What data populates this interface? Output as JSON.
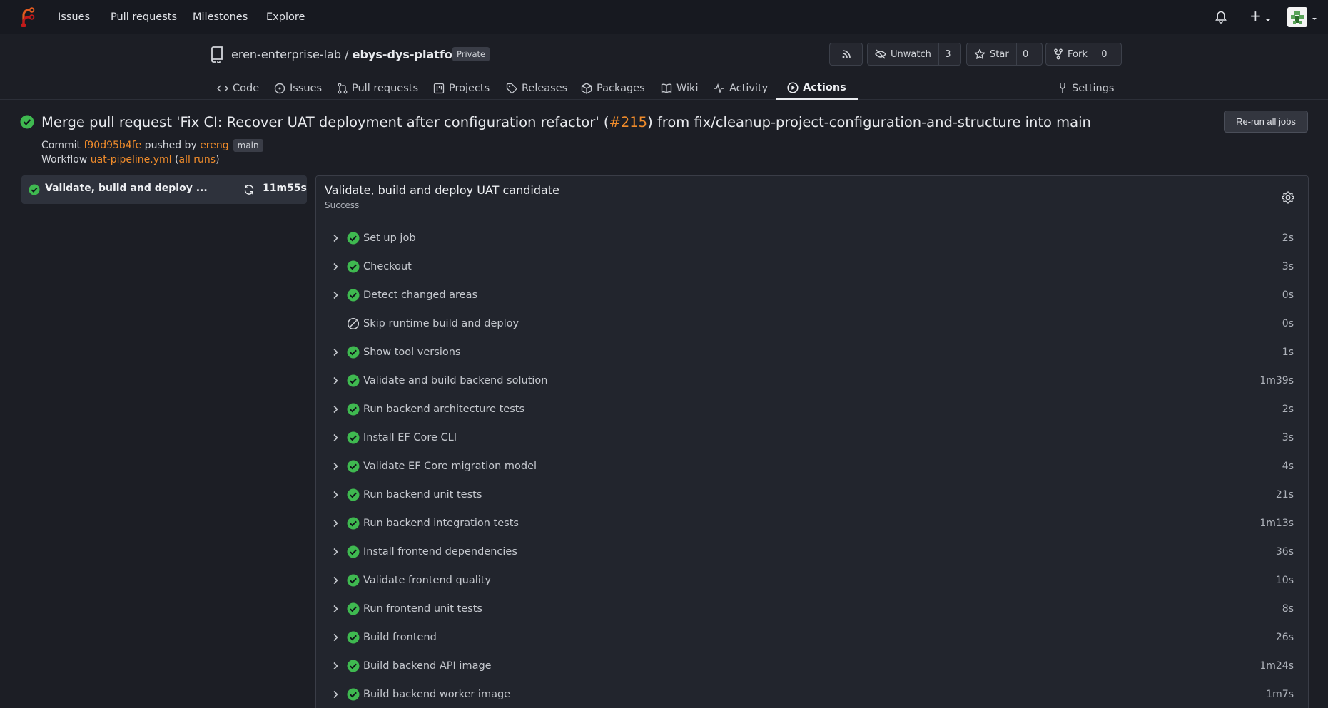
{
  "topnav": {
    "links": [
      "Issues",
      "Pull requests",
      "Milestones",
      "Explore"
    ],
    "plus_label": "+"
  },
  "repo": {
    "owner": "eren-enterprise-lab",
    "separator": " / ",
    "name": "ebys-dys-platform",
    "visibility": "Private",
    "watch": {
      "label": "Unwatch",
      "count": "3"
    },
    "star": {
      "label": "Star",
      "count": "0"
    },
    "fork": {
      "label": "Fork",
      "count": "0"
    }
  },
  "tabs": [
    {
      "label": "Code",
      "icon": "code-icon"
    },
    {
      "label": "Issues",
      "icon": "issue-icon"
    },
    {
      "label": "Pull requests",
      "icon": "pull-request-icon"
    },
    {
      "label": "Projects",
      "icon": "project-icon"
    },
    {
      "label": "Releases",
      "icon": "tag-icon"
    },
    {
      "label": "Packages",
      "icon": "package-icon"
    },
    {
      "label": "Wiki",
      "icon": "book-icon"
    },
    {
      "label": "Activity",
      "icon": "pulse-icon"
    },
    {
      "label": "Actions",
      "icon": "play-icon",
      "active": true
    },
    {
      "label": "Settings",
      "icon": "tools-icon"
    }
  ],
  "run": {
    "title_before": "Merge pull request 'Fix CI: Recover UAT deployment after configuration refactor' (",
    "pr_ref": "#215",
    "title_after": ") from fix/cleanup-project-configuration-and-structure into main",
    "rerun_label": "Re-run all jobs",
    "commit_label": "Commit ",
    "commit_sha": "f90d95b4fe",
    "pushed_by_label": " pushed by ",
    "pusher": "ereng",
    "branch": "main",
    "workflow_label": "Workflow ",
    "workflow_file": "uat-pipeline.yml",
    "all_runs_open": " (",
    "all_runs": "all runs",
    "all_runs_close": ")"
  },
  "job_list": [
    {
      "name": "Validate, build and deploy ...",
      "duration": "11m55s",
      "status": "success"
    }
  ],
  "job": {
    "title": "Validate, build and deploy UAT candidate",
    "status_text": "Success"
  },
  "steps": [
    {
      "name": "Set up job",
      "duration": "2s",
      "status": "success"
    },
    {
      "name": "Checkout",
      "duration": "3s",
      "status": "success"
    },
    {
      "name": "Detect changed areas",
      "duration": "0s",
      "status": "success"
    },
    {
      "name": "Skip runtime build and deploy",
      "duration": "0s",
      "status": "skipped"
    },
    {
      "name": "Show tool versions",
      "duration": "1s",
      "status": "success"
    },
    {
      "name": "Validate and build backend solution",
      "duration": "1m39s",
      "status": "success"
    },
    {
      "name": "Run backend architecture tests",
      "duration": "2s",
      "status": "success"
    },
    {
      "name": "Install EF Core CLI",
      "duration": "3s",
      "status": "success"
    },
    {
      "name": "Validate EF Core migration model",
      "duration": "4s",
      "status": "success"
    },
    {
      "name": "Run backend unit tests",
      "duration": "21s",
      "status": "success"
    },
    {
      "name": "Run backend integration tests",
      "duration": "1m13s",
      "status": "success"
    },
    {
      "name": "Install frontend dependencies",
      "duration": "36s",
      "status": "success"
    },
    {
      "name": "Validate frontend quality",
      "duration": "10s",
      "status": "success"
    },
    {
      "name": "Run frontend unit tests",
      "duration": "8s",
      "status": "success"
    },
    {
      "name": "Build frontend",
      "duration": "26s",
      "status": "success"
    },
    {
      "name": "Build backend API image",
      "duration": "1m24s",
      "status": "success"
    },
    {
      "name": "Build backend worker image",
      "duration": "1m7s",
      "status": "success"
    }
  ],
  "colors": {
    "accent": "#f08c2b",
    "success": "#3fb950",
    "background": "#1c1e25"
  }
}
